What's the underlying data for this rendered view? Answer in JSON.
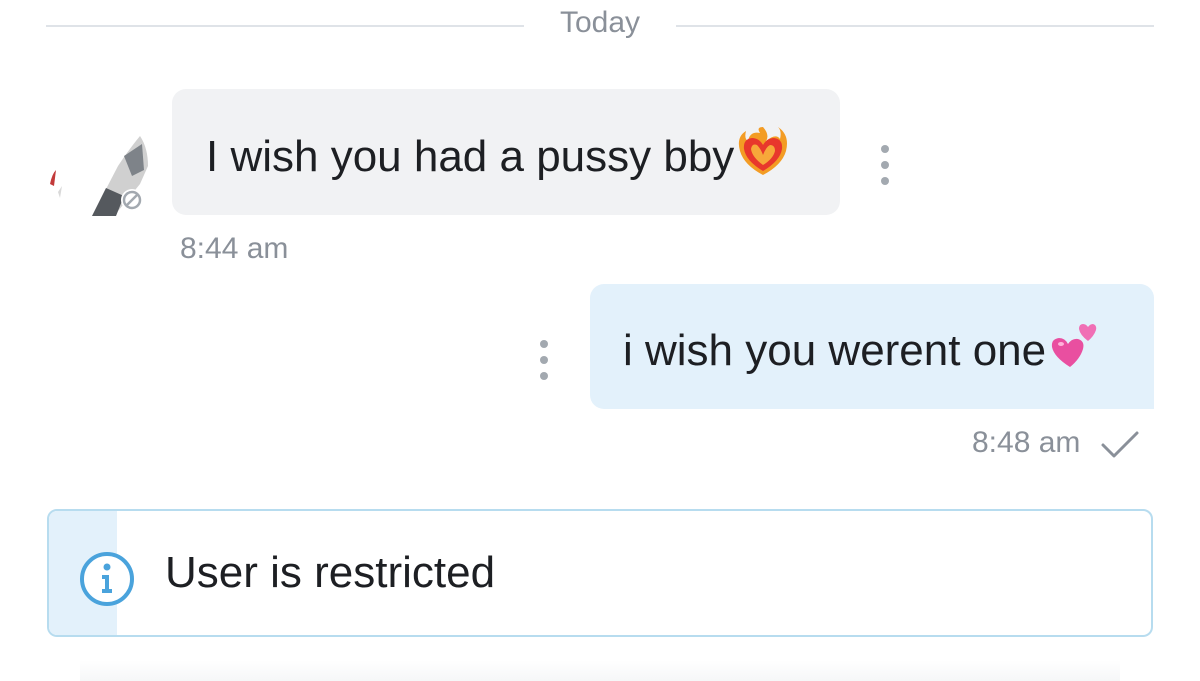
{
  "chat": {
    "date_divider": "Today",
    "messages": [
      {
        "direction": "incoming",
        "text": "I wish you had a pussy bby",
        "emoji": "heart-on-fire-emoji",
        "time": "8:44 am"
      },
      {
        "direction": "outgoing",
        "text": "i wish you werent one",
        "emoji": "two-hearts-emoji",
        "time": "8:48 am",
        "status": "sent-check"
      }
    ],
    "notice": {
      "icon": "info-icon",
      "text": "User is restricted"
    }
  },
  "colors": {
    "incoming_bubble": "#f1f2f4",
    "outgoing_bubble": "#e3f1fb",
    "meta_text": "#8a9099",
    "notice_border": "#b7dcef",
    "accent_blue": "#4aa3dc"
  }
}
